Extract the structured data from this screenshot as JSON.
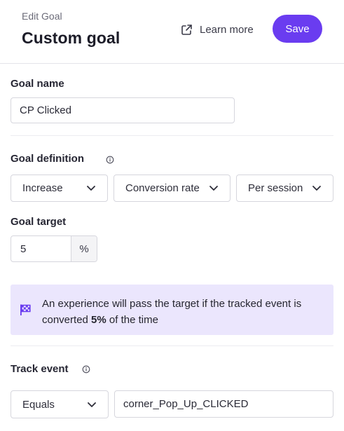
{
  "header": {
    "eyebrow": "Edit Goal",
    "title": "Custom goal",
    "learn_more_label": "Learn more",
    "save_label": "Save"
  },
  "goal_name": {
    "label": "Goal name",
    "value": "CP Clicked"
  },
  "goal_definition": {
    "label": "Goal definition",
    "direction": "Increase",
    "metric": "Conversion rate",
    "scope": "Per session"
  },
  "goal_target": {
    "label": "Goal target",
    "value": "5",
    "unit": "%"
  },
  "callout": {
    "text_before": "An experience will pass the target if the tracked event is converted ",
    "highlight": "5%",
    "text_after": " of the time"
  },
  "track_event": {
    "label": "Track event",
    "operator": "Equals",
    "event_name": "corner_Pop_Up_CLICKED"
  },
  "colors": {
    "accent": "#6a3cf0",
    "callout_bg": "#ebe6fd"
  },
  "icons": {
    "external_link": "external-link-icon",
    "info": "info-icon",
    "chevron": "chevron-down-icon",
    "flag": "checkered-flag-icon"
  }
}
